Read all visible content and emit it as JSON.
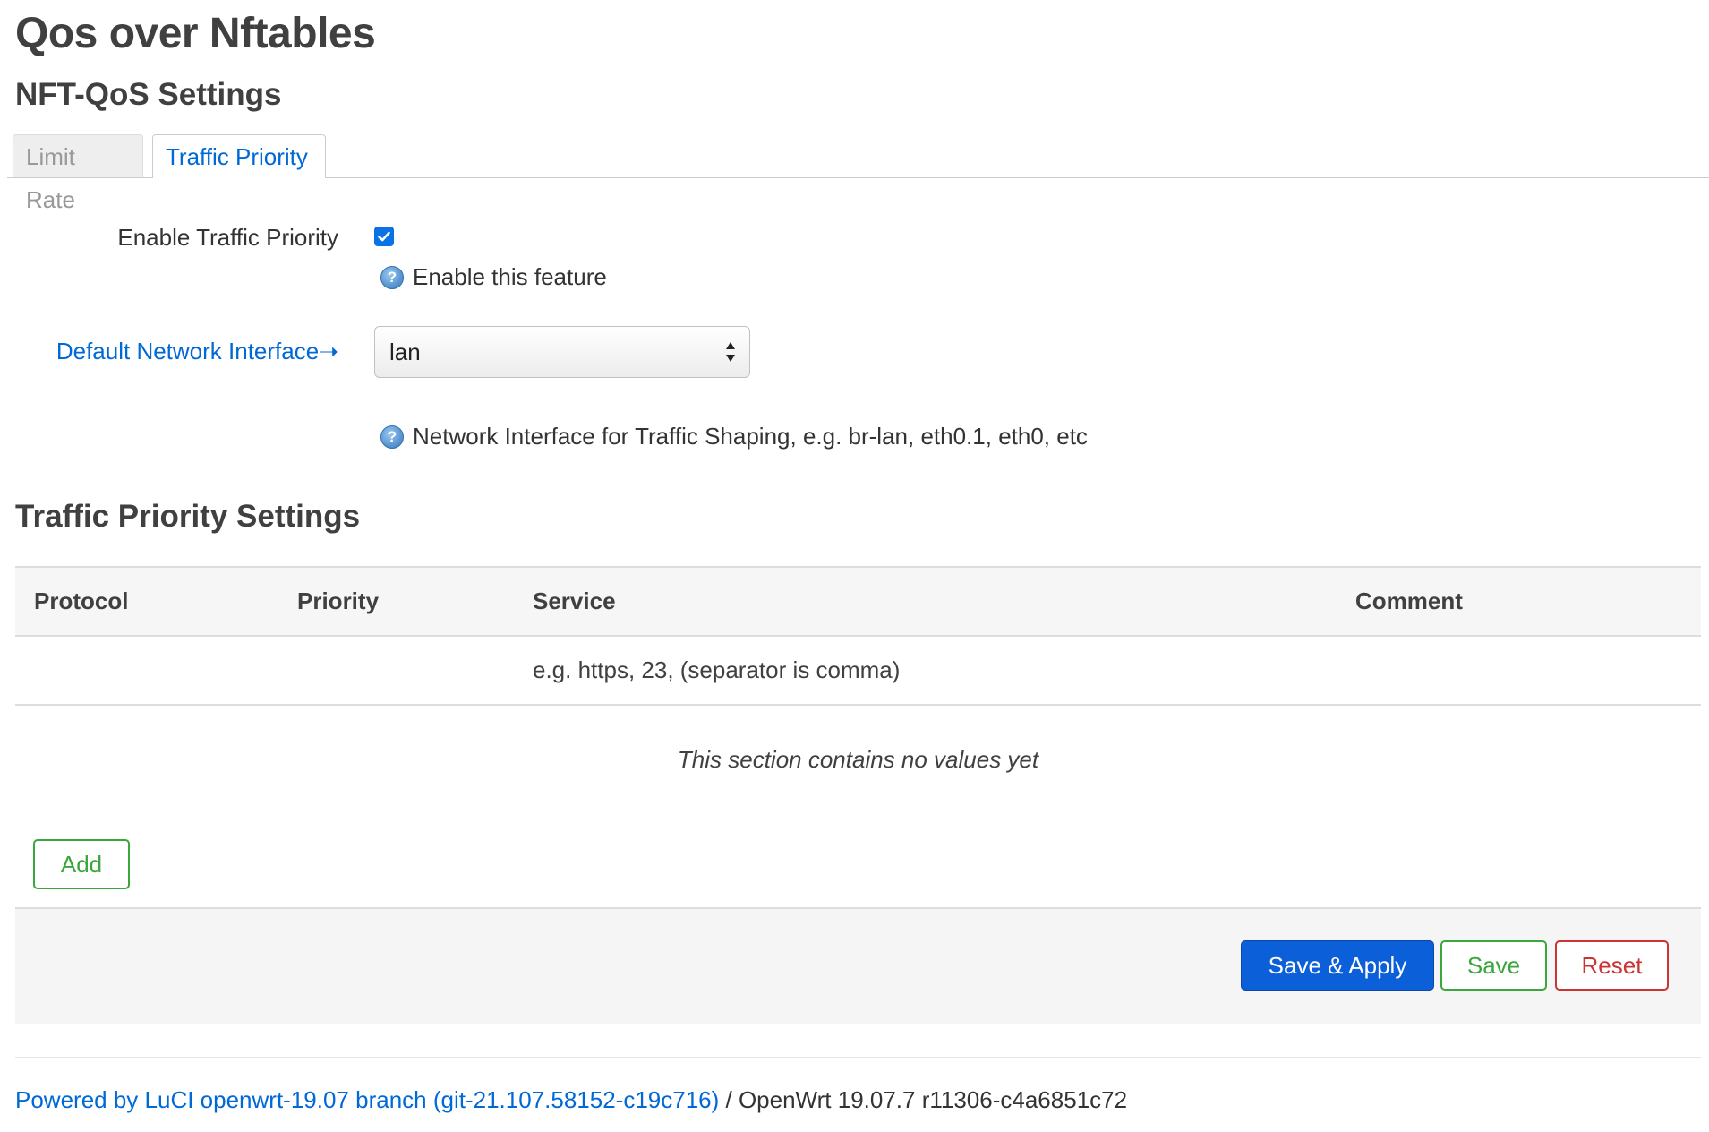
{
  "page": {
    "title": "Qos over Nftables"
  },
  "settings": {
    "title": "NFT-QoS Settings",
    "tabs": [
      {
        "label": "Limit Rate",
        "active": false
      },
      {
        "label": "Traffic Priority",
        "active": true
      }
    ],
    "enable": {
      "label": "Enable Traffic Priority",
      "checked": true,
      "help": "Enable this feature"
    },
    "interface": {
      "label": "Default Network Interface",
      "value": "lan",
      "help": "Network Interface for Traffic Shaping, e.g. br-lan, eth0.1, eth0, etc"
    }
  },
  "priority": {
    "title": "Traffic Priority Settings",
    "columns": [
      "Protocol",
      "Priority",
      "Service",
      "Comment"
    ],
    "service_hint": "e.g. https, 23, (separator is comma)",
    "empty_text": "This section contains no values yet",
    "add_label": "Add"
  },
  "actions": {
    "save_apply": "Save & Apply",
    "save": "Save",
    "reset": "Reset"
  },
  "footer": {
    "link_text": "Powered by LuCI openwrt-19.07 branch (git-21.107.58152-c19c716)",
    "rest_text": " / OpenWrt 19.07.7 r11306-c4a6851c72"
  },
  "colors": {
    "link": "#0069d6",
    "primary": "#0b5fd9",
    "success": "#3ba63b",
    "danger": "#cc3333",
    "checkbox": "#0b72e5"
  }
}
